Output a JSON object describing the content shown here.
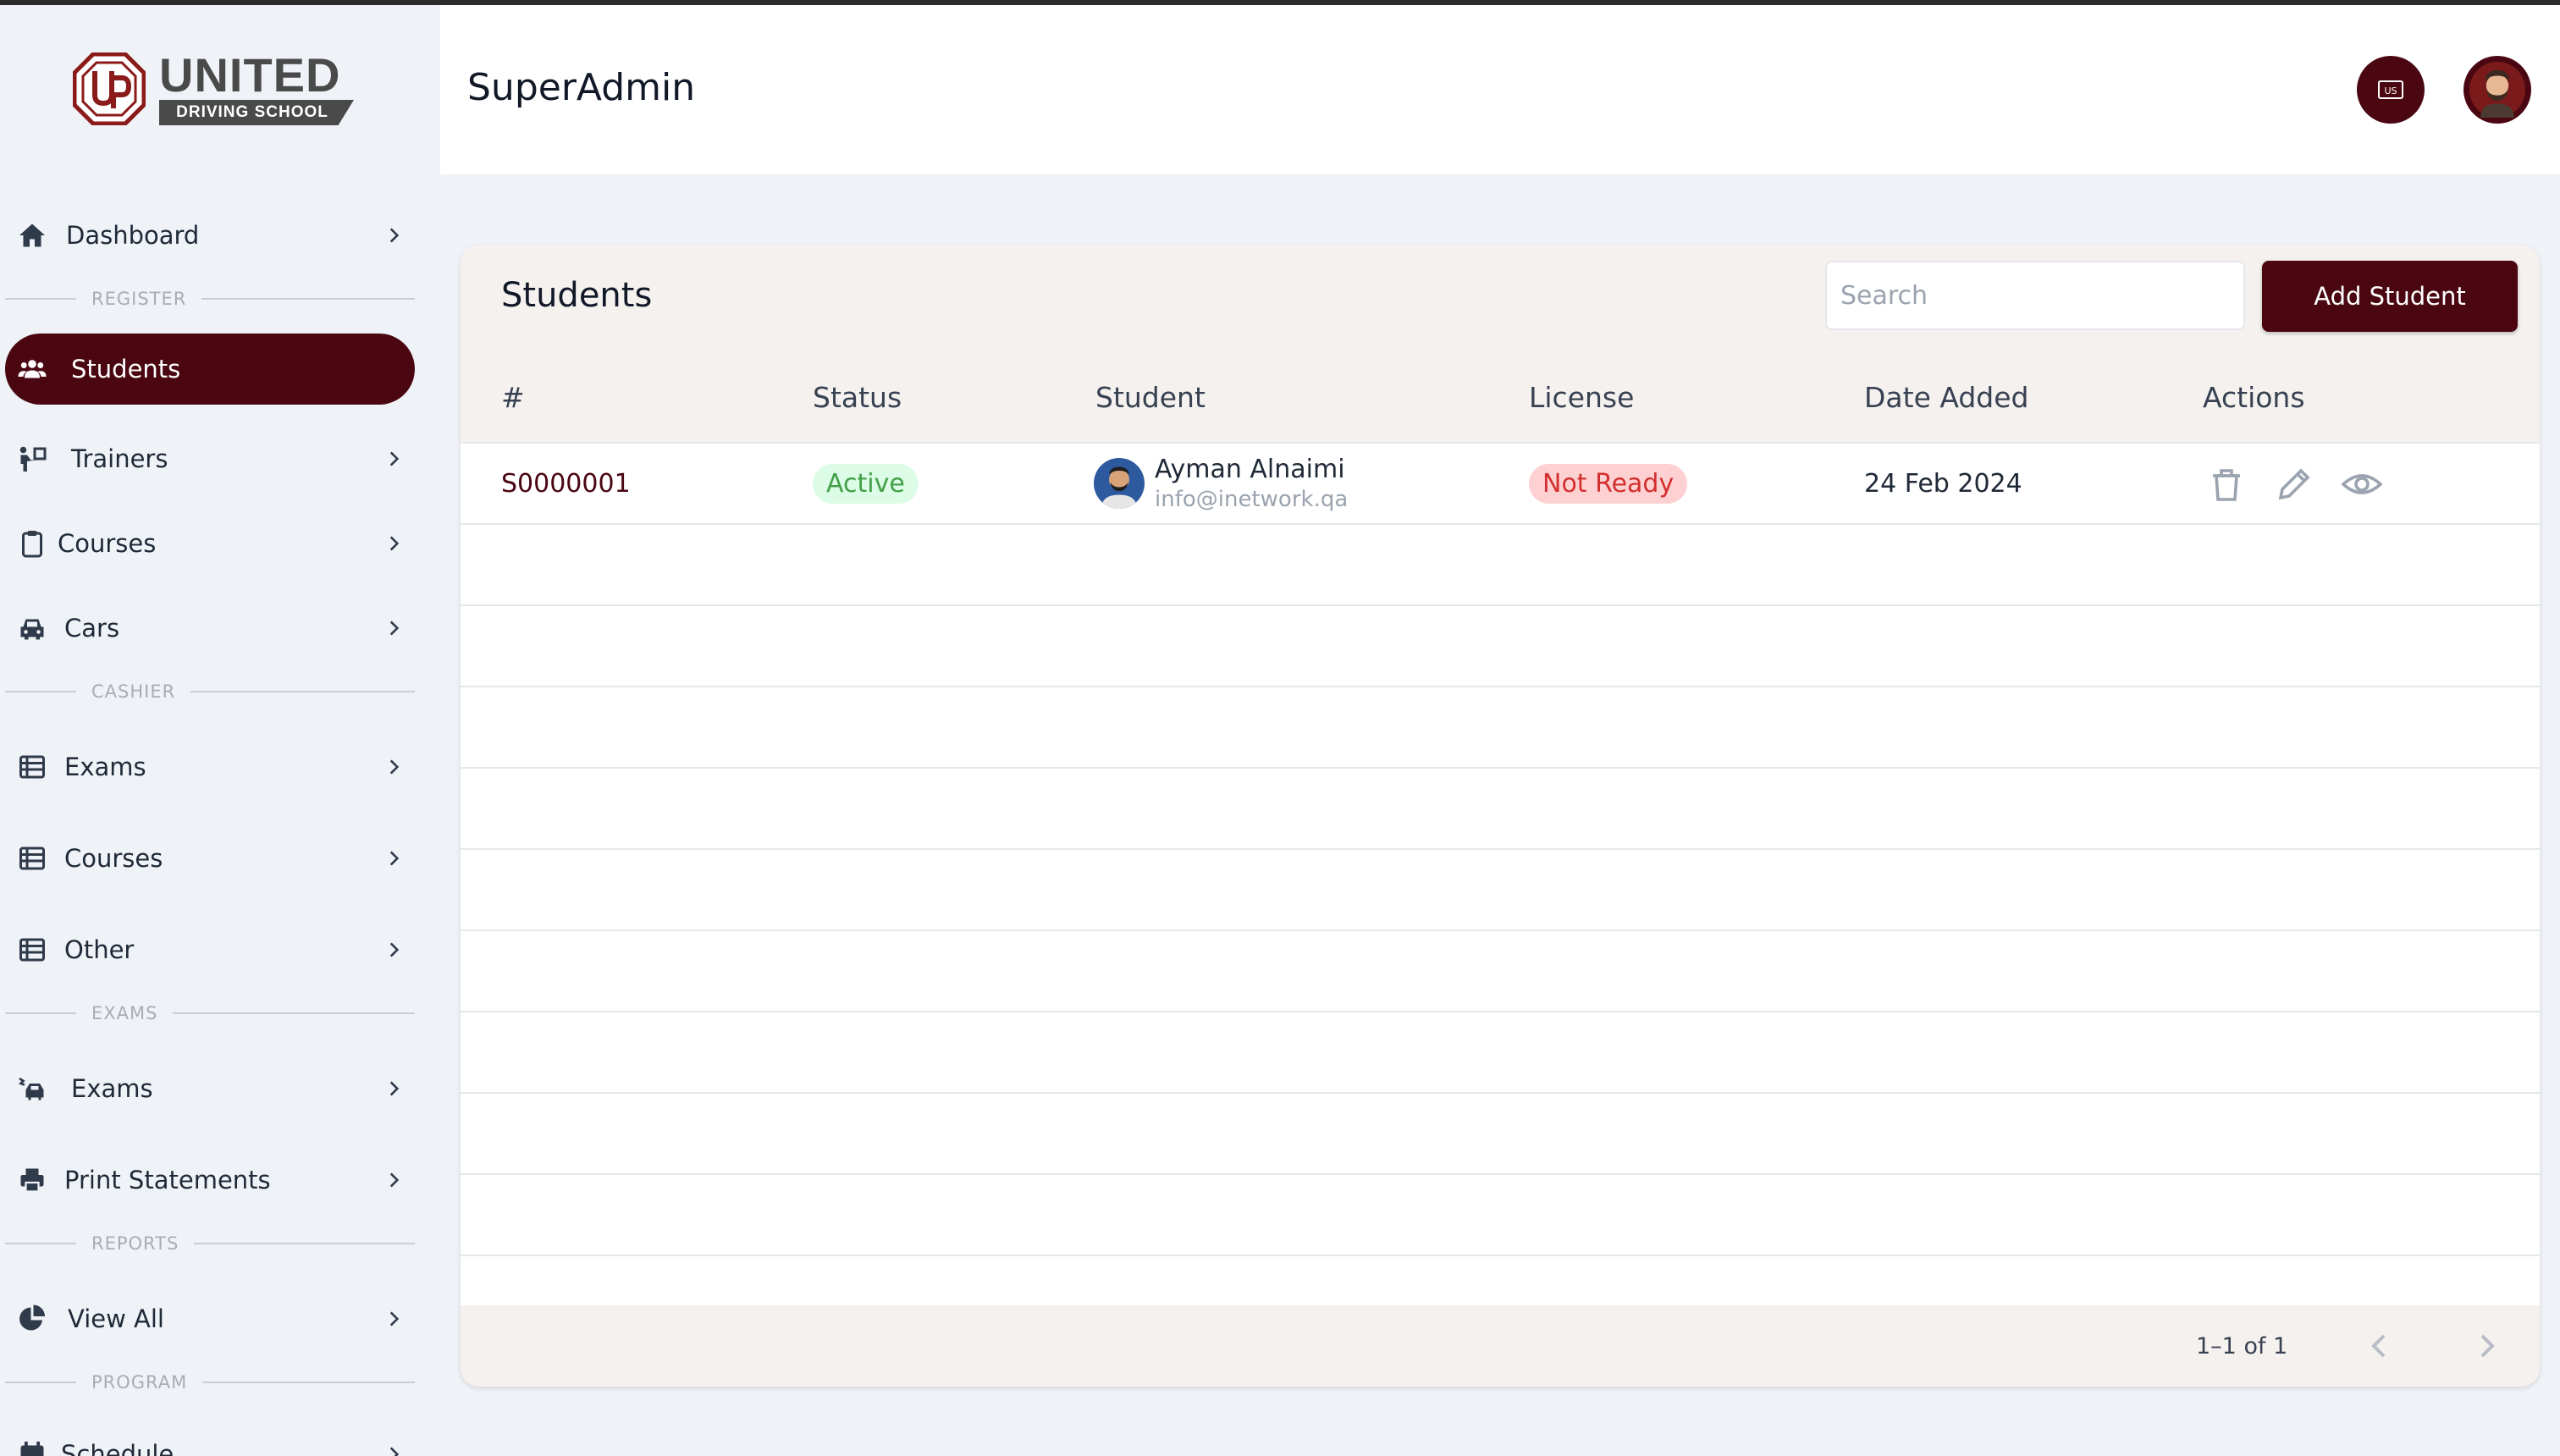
{
  "brand": {
    "name": "UNITED",
    "tagline": "DRIVING SCHOOL",
    "badge_color": "#8b1a1a"
  },
  "header": {
    "title": "SuperAdmin",
    "language_icon": "flag-us-icon",
    "user_avatar": "user-avatar-icon",
    "accent": "#4a0711"
  },
  "sidebar": {
    "items": [
      {
        "label": "Dashboard",
        "icon": "home-icon"
      },
      {
        "section": "REGISTER"
      },
      {
        "label": "Students",
        "icon": "users-icon",
        "active": true
      },
      {
        "label": "Trainers",
        "icon": "trainer-icon"
      },
      {
        "label": "Courses",
        "icon": "clipboard-icon"
      },
      {
        "label": "Cars",
        "icon": "car-icon"
      },
      {
        "section": "CASHIER"
      },
      {
        "label": "Exams",
        "icon": "table-icon"
      },
      {
        "label": "Courses",
        "icon": "table-icon"
      },
      {
        "label": "Other",
        "icon": "table-icon"
      },
      {
        "section": "EXAMS"
      },
      {
        "label": "Exams",
        "icon": "car-crash-icon"
      },
      {
        "label": "Print Statements",
        "icon": "printer-icon"
      },
      {
        "section": "REPORTS"
      },
      {
        "label": "View All",
        "icon": "pie-chart-icon"
      },
      {
        "section": "PROGRAM"
      },
      {
        "label": "Schedule",
        "icon": "calendar-icon"
      }
    ]
  },
  "students": {
    "title": "Students",
    "search_placeholder": "Search",
    "add_button": "Add Student",
    "columns": [
      "#",
      "Status",
      "Student",
      "License",
      "Date Added",
      "Actions"
    ],
    "rows": [
      {
        "id": "S0000001",
        "status": "Active",
        "name": "Ayman Alnaimi",
        "email": "info@inetwork.qa",
        "license": "Not Ready",
        "date_added": "24 Feb 2024",
        "actions": [
          "delete-icon",
          "edit-icon",
          "view-icon"
        ]
      }
    ],
    "pagination": {
      "range_text": "1–1 of 1"
    }
  },
  "colors": {
    "primary": "#4a0711",
    "active_badge_bg": "#dcfce7",
    "active_badge_fg": "#43a047",
    "notready_badge_bg": "#fdd1d1",
    "notready_badge_fg": "#d32f2f"
  }
}
